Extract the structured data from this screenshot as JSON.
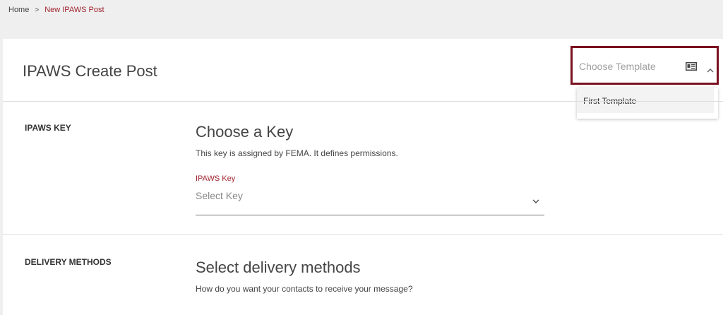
{
  "breadcrumb": {
    "home": "Home",
    "separator": ">",
    "current": "New IPAWS Post"
  },
  "header": {
    "title": "IPAWS Create Post"
  },
  "template": {
    "placeholder": "Choose Template",
    "options": [
      "First Template"
    ]
  },
  "sections": {
    "key": {
      "label": "IPAWS KEY",
      "heading": "Choose a Key",
      "description": "This key is assigned by FEMA. It defines permissions.",
      "field_label": "IPAWS Key",
      "placeholder": "Select Key"
    },
    "delivery": {
      "label": "DELIVERY METHODS",
      "heading": "Select delivery methods",
      "description": "How do you want your contacts to receive your message?"
    }
  },
  "colors": {
    "accent": "#a0252f",
    "highlight_border": "#7a1020"
  },
  "icons": {
    "template_icon": "id-card-icon",
    "template_chevron": "chevron-up-icon",
    "key_chevron": "chevron-down-icon"
  }
}
